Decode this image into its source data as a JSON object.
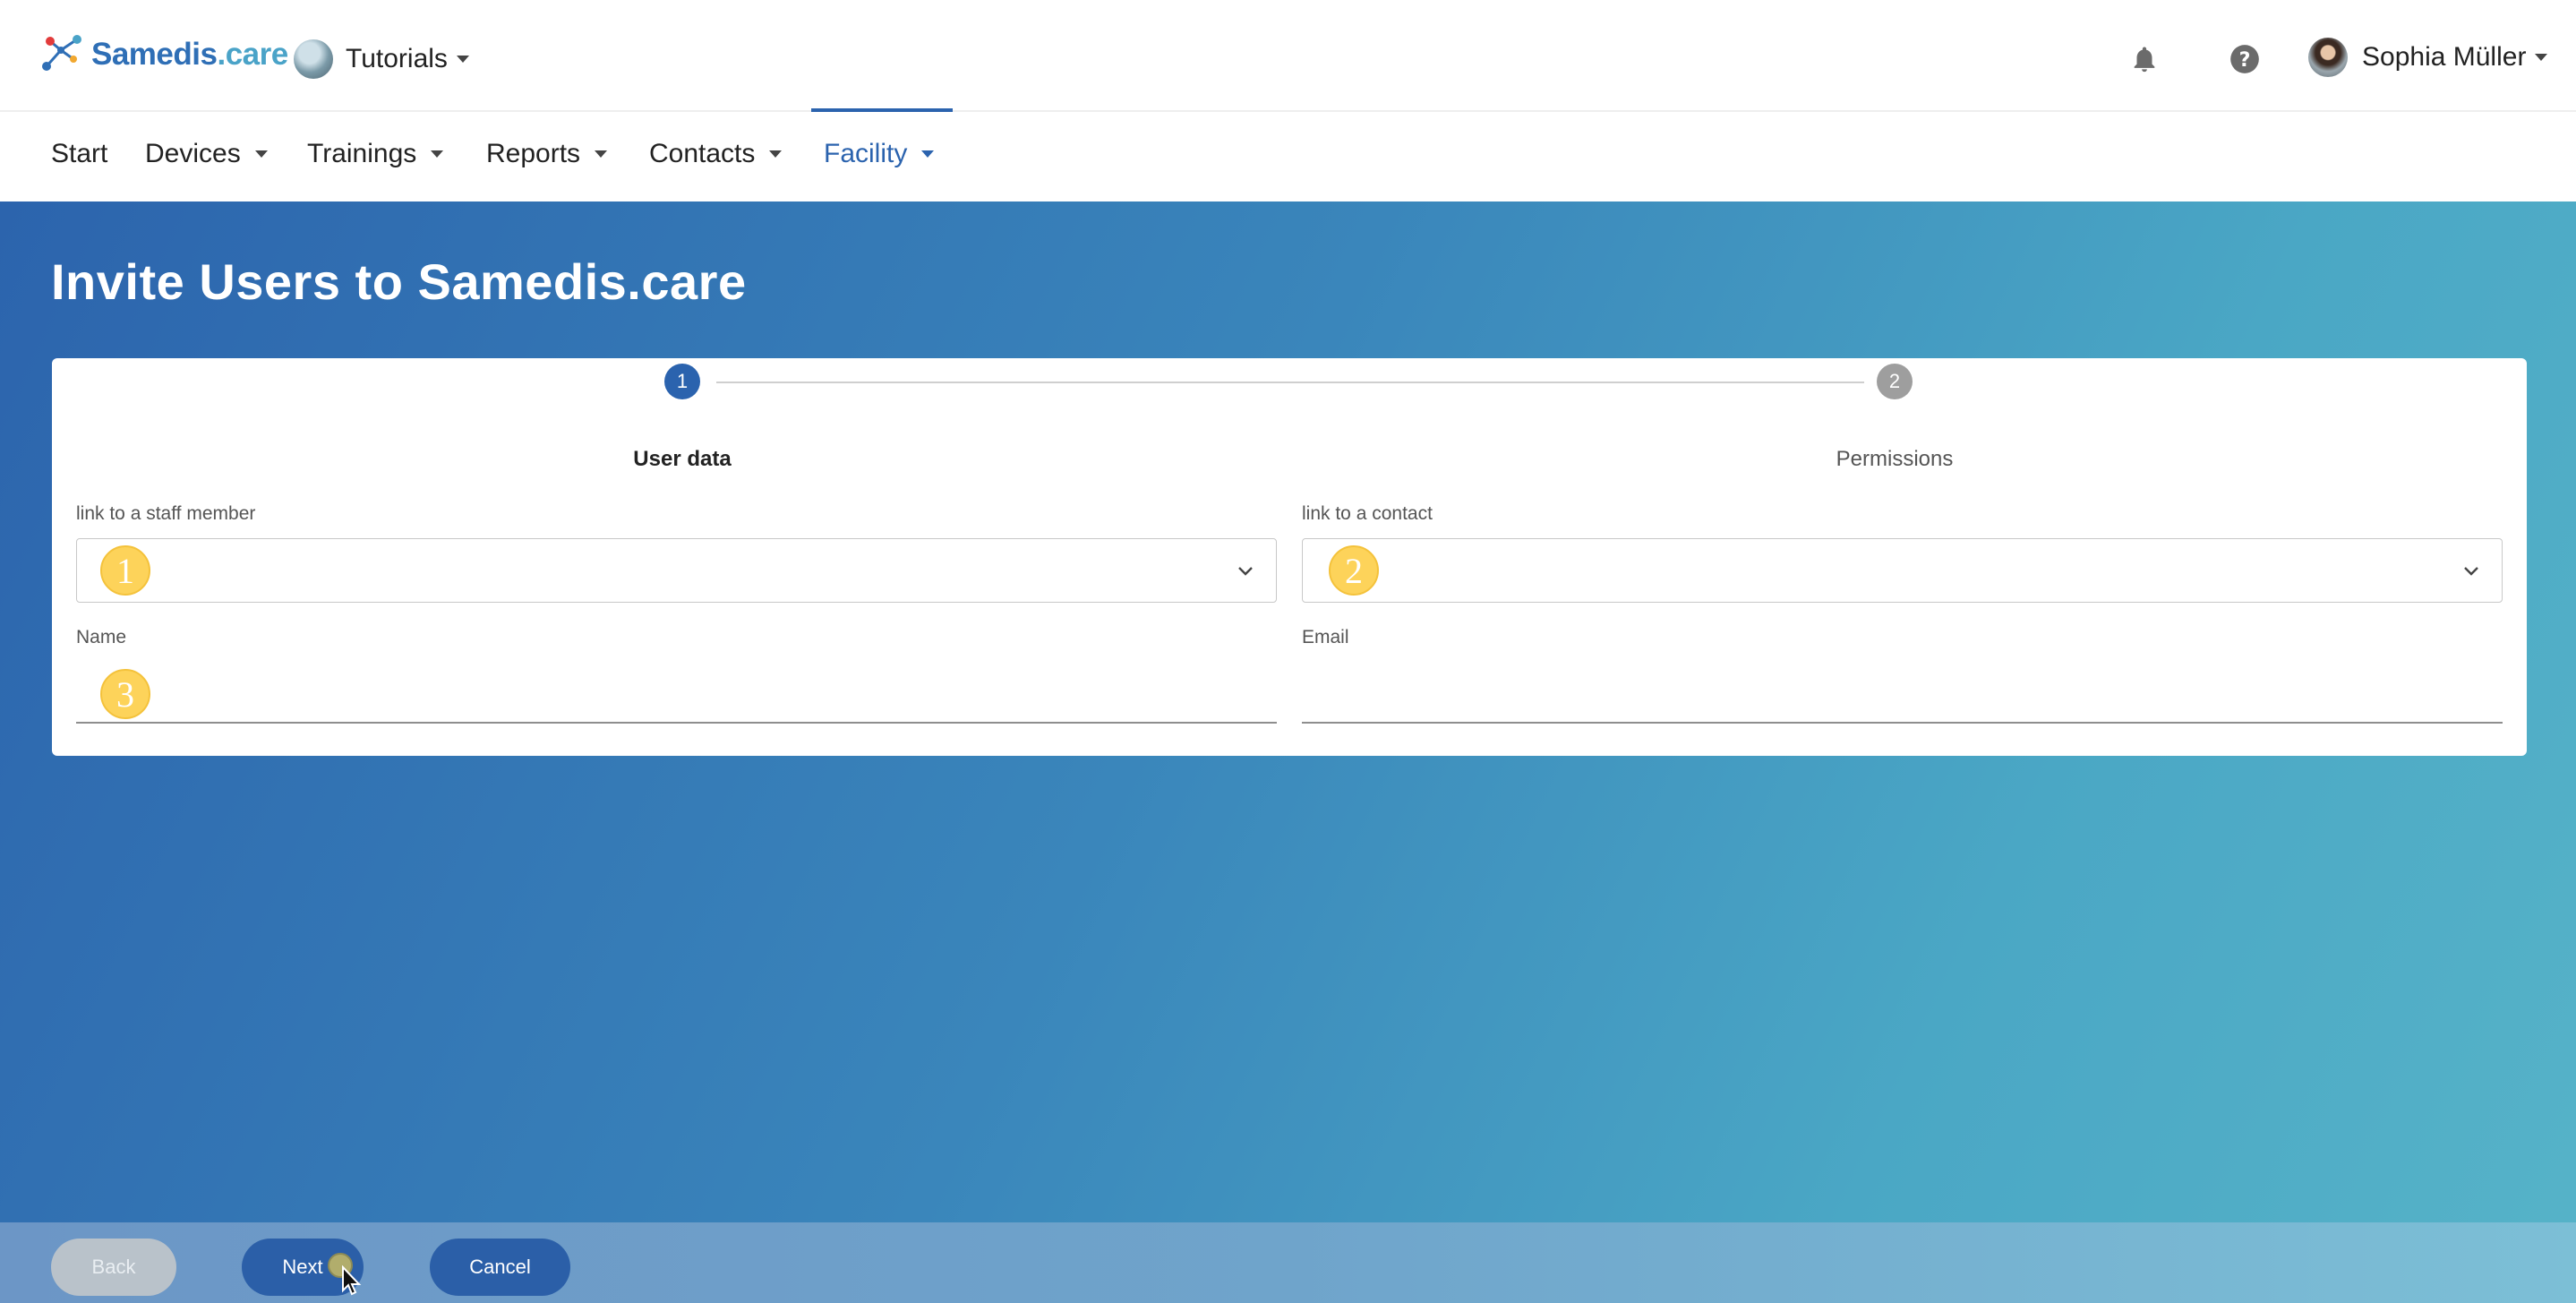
{
  "header": {
    "logo_text": "Samedis",
    "logo_suffix": ".care",
    "tenant_label": "Tutorials",
    "notification_icon": "bell-icon",
    "help_icon": "help-circle-icon",
    "user_name": "Sophia Müller"
  },
  "nav": {
    "items": [
      {
        "label": "Start"
      },
      {
        "label": "Devices"
      },
      {
        "label": "Trainings"
      },
      {
        "label": "Reports"
      },
      {
        "label": "Contacts"
      },
      {
        "label": "Facility"
      }
    ],
    "active": "Facility"
  },
  "page": {
    "title": "Invite Users to Samedis.care"
  },
  "stepper": {
    "steps": [
      {
        "number": "1",
        "label": "User data",
        "state": "active"
      },
      {
        "number": "2",
        "label": "Permissions",
        "state": "inactive"
      }
    ]
  },
  "form": {
    "staff_label": "link to a staff member",
    "staff_value": "",
    "contact_label": "link to a contact",
    "contact_value": "",
    "name_label": "Name",
    "name_value": "",
    "email_label": "Email",
    "email_value": ""
  },
  "markers": [
    "1",
    "2",
    "3"
  ],
  "footer": {
    "back_label": "Back",
    "next_label": "Next",
    "cancel_label": "Cancel"
  },
  "colors": {
    "primary": "#2b63ae",
    "marker": "#fdd35a",
    "step_inactive": "#9e9e9e"
  }
}
